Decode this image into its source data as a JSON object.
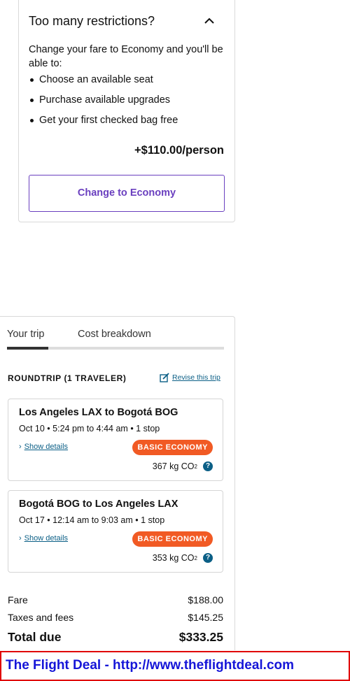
{
  "restrictions": {
    "title": "Too many restrictions?",
    "intro": "Change your fare to Economy and you'll be able to:",
    "benefits": [
      "Choose an available seat",
      "Purchase available upgrades",
      "Get your first checked bag free"
    ],
    "price": "+$110.00/person",
    "button_label": "Change to Economy"
  },
  "trip": {
    "tabs": [
      "Your trip",
      "Cost breakdown"
    ],
    "header": "ROUNDTRIP (1 TRAVELER)",
    "revise_label": "Revise this trip",
    "flights": [
      {
        "route": "Los Angeles LAX to Bogotá BOG",
        "times": "Oct 10 • 5:24 pm to 4:44 am • 1 stop",
        "details_label": "Show details",
        "badge": "BASIC ECONOMY",
        "co2": "367 kg CO",
        "co2_sub": "2"
      },
      {
        "route": "Bogotá BOG to Los Angeles LAX",
        "times": "Oct 17 • 12:14 am to 9:03 am • 1 stop",
        "details_label": "Show details",
        "badge": "BASIC ECONOMY",
        "co2": "353 kg CO",
        "co2_sub": "2"
      }
    ],
    "costs": {
      "fare_label": "Fare",
      "fare_value": "$188.00",
      "tax_label": "Taxes and fees",
      "tax_value": "$145.25",
      "total_label": "Total due",
      "total_value": "$333.25"
    }
  },
  "watermark": "The Flight Deal - http://www.theflightdeal.com",
  "colors": {
    "accent_purple": "#6a3fbf",
    "badge_orange": "#f15a24",
    "link_blue": "#0b5f86",
    "watermark_red": "#e00000",
    "watermark_text": "#1515d8"
  }
}
